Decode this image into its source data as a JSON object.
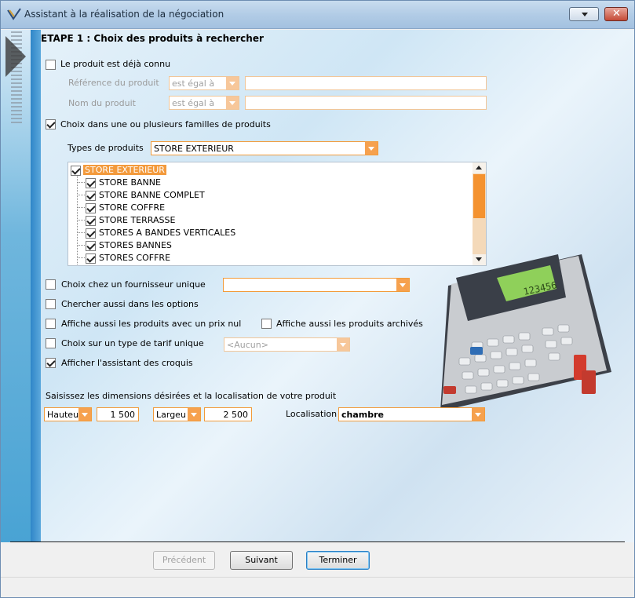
{
  "window": {
    "title": "Assistant à la réalisation de la négociation",
    "close_label": "✕"
  },
  "step": {
    "heading": "ETAPE 1 : Choix des produits à rechercher"
  },
  "known_product": {
    "checkbox_label": "Le produit est déjà connu",
    "checked": false,
    "reference_label": "Référence du produit",
    "reference_operator": "est égal à",
    "reference_value": "",
    "name_label": "Nom du produit",
    "name_operator": "est égal à",
    "name_value": ""
  },
  "families": {
    "checkbox_label": "Choix dans une ou plusieurs familles de produits",
    "checked": true,
    "types_label": "Types de produits",
    "types_value": "STORE EXTERIEUR",
    "tree": {
      "root": "STORE EXTERIEUR",
      "items": [
        "STORE BANNE",
        "STORE BANNE COMPLET",
        "STORE COFFRE",
        "STORE TERRASSE",
        "STORES A BANDES VERTICALES",
        "STORES BANNES",
        "STORES COFFRE"
      ]
    }
  },
  "options": {
    "single_supplier_label": "Choix chez un fournisseur unique",
    "single_supplier_value": "",
    "search_options_label": "Chercher aussi dans les options",
    "zero_price_label": "Affiche aussi les produits avec un prix nul",
    "archived_label": "Affiche aussi les produits archivés",
    "tariff_label": "Choix sur un type de tarif unique",
    "tariff_value": "<Aucun>",
    "sketch_assistant_label": "Afficher l'assistant des croquis",
    "sketch_assistant_checked": true
  },
  "dimensions": {
    "prompt": "Saisissez les dimensions désirées et la localisation de votre produit",
    "dim1_label": "Hauteu",
    "dim1_value": "1 500",
    "dim2_label": "Largeu",
    "dim2_value": "2 500",
    "location_label": "Localisation",
    "location_value": "chambre"
  },
  "calculator": {
    "display": "123456"
  },
  "buttons": {
    "previous": "Précédent",
    "next": "Suivant",
    "finish": "Terminer"
  },
  "colors": {
    "accent": "#f29b3a",
    "titlebar": "#b2cce6",
    "strip": "#49a3d4"
  }
}
